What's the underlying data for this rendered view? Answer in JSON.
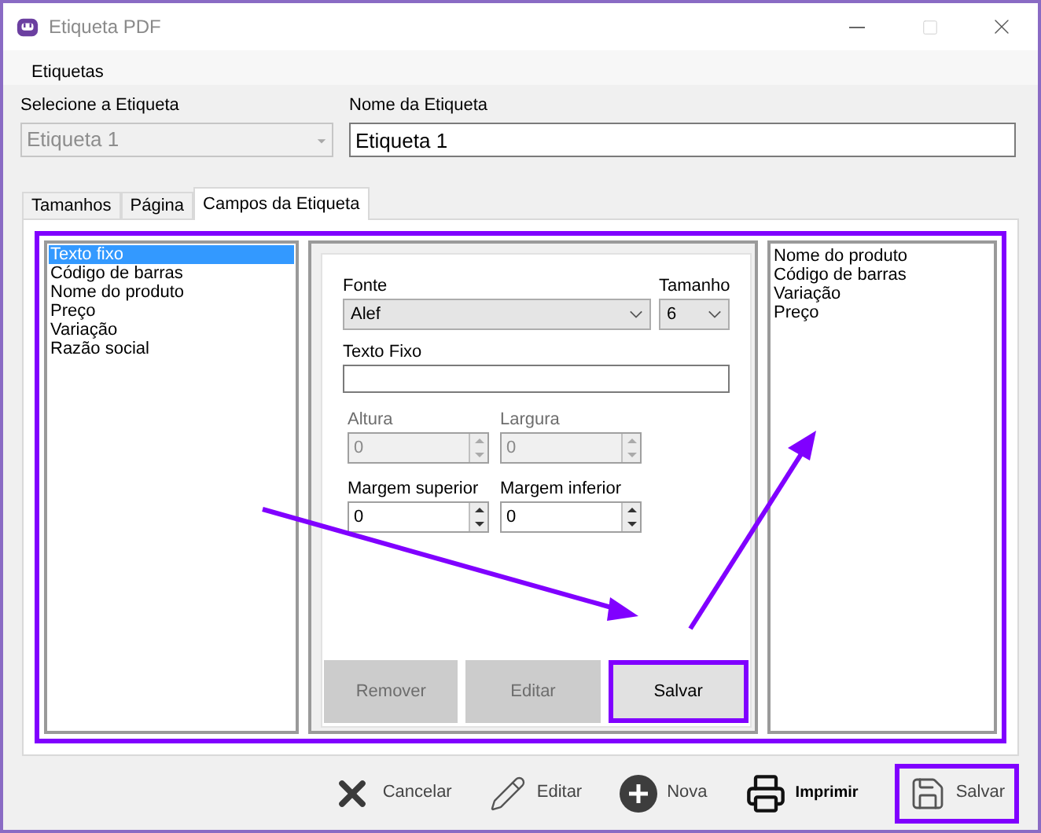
{
  "window": {
    "title": "Etiqueta PDF"
  },
  "menu": [
    "Etiquetas"
  ],
  "select_label": {
    "label": "Selecione a Etiqueta",
    "value": "Etiqueta 1",
    "disabled": true
  },
  "name_field": {
    "label": "Nome da Etiqueta",
    "value": "Etiqueta 1"
  },
  "tabs": [
    {
      "label": "Tamanhos",
      "selected": false
    },
    {
      "label": "Página",
      "selected": false
    },
    {
      "label": "Campos da Etiqueta",
      "selected": true
    }
  ],
  "panels_highlighted": true,
  "fields_list": [
    {
      "label": "Texto fixo",
      "selected": true
    },
    {
      "label": "Código de barras",
      "selected": false
    },
    {
      "label": "Nome do produto",
      "selected": false
    },
    {
      "label": "Preço",
      "selected": false
    },
    {
      "label": "Variação",
      "selected": false
    },
    {
      "label": "Razão social",
      "selected": false
    }
  ],
  "form": {
    "font": {
      "label": "Fonte",
      "value": "Alef"
    },
    "size": {
      "label": "Tamanho",
      "value": "6"
    },
    "fixed_text": {
      "label": "Texto Fixo"
    },
    "spinners": [
      {
        "label": "Altura",
        "value": "0",
        "disabled": true
      },
      {
        "label": "Largura",
        "value": "0",
        "disabled": true
      },
      {
        "label": "Margem superior",
        "value": "0",
        "disabled": false
      },
      {
        "label": "Margem inferior",
        "value": "0",
        "disabled": false
      }
    ],
    "buttons": [
      {
        "label": "Remover",
        "disabled": true,
        "highlighted": false
      },
      {
        "label": "Editar",
        "disabled": true,
        "highlighted": false
      },
      {
        "label": "Salvar",
        "disabled": false,
        "highlighted": true
      }
    ]
  },
  "selected_fields": [
    "Nome do produto",
    "Código de barras",
    "Variação",
    "Preço"
  ],
  "toolbar": [
    {
      "label": "Cancelar",
      "kind": "cancel",
      "highlighted": false
    },
    {
      "label": "Editar",
      "kind": "edit",
      "highlighted": false
    },
    {
      "label": "Nova",
      "kind": "new",
      "highlighted": false
    },
    {
      "label": "Imprimir",
      "kind": "print",
      "highlighted": false
    },
    {
      "label": "Salvar",
      "kind": "save",
      "highlighted": true
    }
  ]
}
